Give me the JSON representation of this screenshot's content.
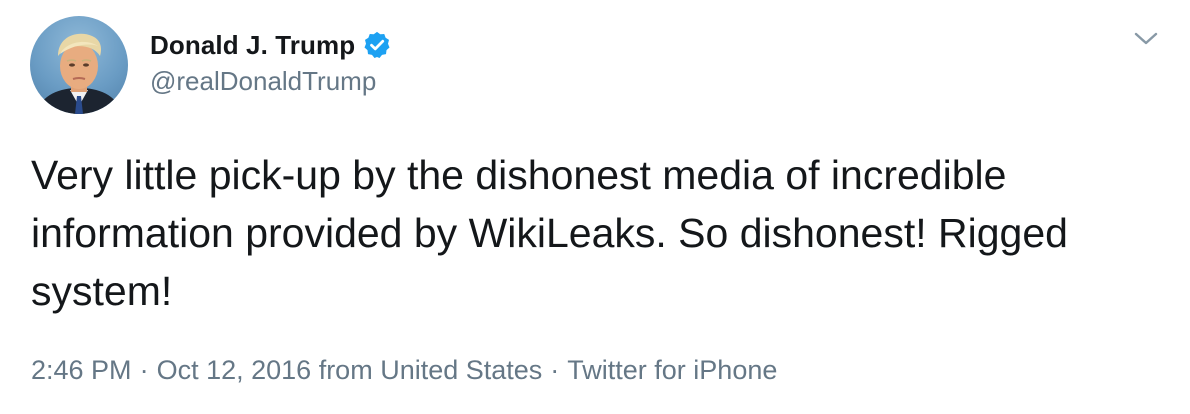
{
  "author": {
    "display_name": "Donald J. Trump",
    "handle": "@realDonaldTrump",
    "verified": true,
    "verified_color": "#1da1f2"
  },
  "menu": {
    "icon": "chevron-down-icon"
  },
  "tweet": {
    "text": "Very little pick-up by the dishonest media of incredible information provided by WikiLeaks. So dishonest! Rigged system!"
  },
  "meta": {
    "time": "2:46 PM",
    "date": "Oct 12, 2016",
    "location": "from United States",
    "separator": "·",
    "source": "Twitter for iPhone"
  },
  "colors": {
    "text_primary": "#14171a",
    "text_secondary": "#657786",
    "accent": "#1da1f2"
  }
}
